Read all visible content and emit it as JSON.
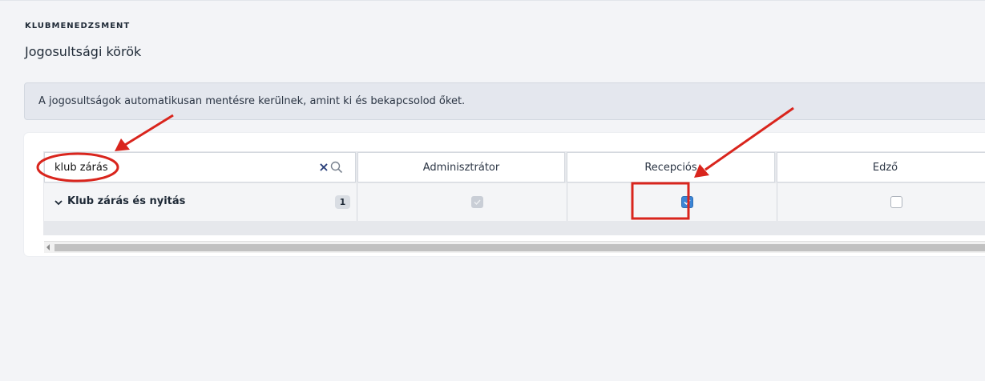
{
  "header": {
    "eyebrow": "KLUBMENEDZSMENT",
    "title": "Jogosultsági körök"
  },
  "notice": {
    "text": "A jogosultságok automatikusan mentésre kerülnek, amint ki és bekapcsolod őket."
  },
  "table": {
    "search": {
      "value": "klub zárás",
      "clear_icon": "close-icon",
      "search_icon": "search-icon"
    },
    "columns": [
      "Adminisztrátor",
      "Recepciós",
      "Edző"
    ],
    "rows": [
      {
        "label": "Klub zárás és nyitás",
        "count": "1",
        "permissions": [
          {
            "role": "Adminisztrátor",
            "checked": true,
            "disabled": true
          },
          {
            "role": "Recepciós",
            "checked": true,
            "disabled": false
          },
          {
            "role": "Edző",
            "checked": false,
            "disabled": false
          }
        ]
      }
    ]
  },
  "annotations": {
    "color": "#d9251d"
  },
  "colors": {
    "checkbox_checked": "#3b85d6",
    "checkbox_disabled": "#c9ced6",
    "notice_bg": "#e4e7ee"
  }
}
